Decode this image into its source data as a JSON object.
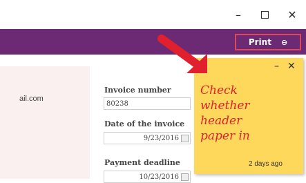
{
  "window": {
    "minimize_glyph": "–",
    "close_glyph": "✕"
  },
  "header": {
    "print_label": "Print",
    "print_icon": "⊖"
  },
  "customer": {
    "email_fragment": "ail.com"
  },
  "form": {
    "invoice_number_label": "Invoice number",
    "invoice_number_value": "80238",
    "invoice_date_label": "Date of the invoice",
    "invoice_date_value": "9/23/2016",
    "deadline_label": "Payment deadline",
    "deadline_value": "10/23/2016"
  },
  "sticky_note": {
    "text": "Check\nwhether\nheader\npaper in",
    "timestamp": "2 days ago",
    "minimize_glyph": "–",
    "close_glyph": "✕"
  },
  "colors": {
    "header_bg": "#6b2a73",
    "note_bg": "#fdd85a",
    "accent_red": "#e0202e"
  }
}
